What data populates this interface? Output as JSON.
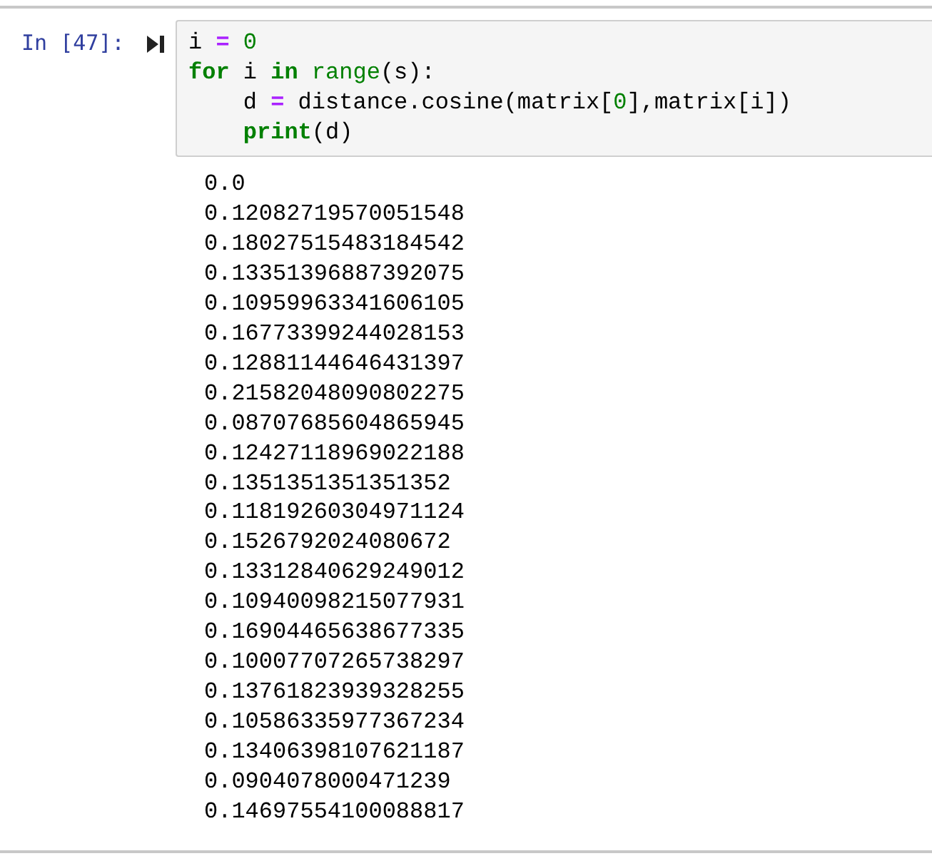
{
  "cell": {
    "prompt": "In [47]:",
    "code_lines": [
      {
        "indented": false,
        "tokens": [
          {
            "text": "i ",
            "kind": "plain"
          },
          {
            "text": "=",
            "kind": "op"
          },
          {
            "text": " 0",
            "kind": "num"
          }
        ]
      },
      {
        "indented": false,
        "tokens": [
          {
            "text": "for",
            "kind": "kw"
          },
          {
            "text": " i ",
            "kind": "plain"
          },
          {
            "text": "in",
            "kind": "kw"
          },
          {
            "text": " range",
            "kind": "builtin"
          },
          {
            "text": "(s):",
            "kind": "plain"
          }
        ]
      },
      {
        "indented": true,
        "tokens": [
          {
            "text": "d ",
            "kind": "plain"
          },
          {
            "text": "=",
            "kind": "op"
          },
          {
            "text": " distance.cosine(matrix[",
            "kind": "plain"
          },
          {
            "text": "0",
            "kind": "num"
          },
          {
            "text": "],matrix[i])",
            "kind": "plain"
          }
        ]
      },
      {
        "indented": true,
        "tokens": [
          {
            "text": "print",
            "kind": "kw"
          },
          {
            "text": "(d)",
            "kind": "plain"
          }
        ]
      }
    ],
    "output": [
      "0.0",
      "0.12082719570051548",
      "0.18027515483184542",
      "0.13351396887392075",
      "0.10959963341606105",
      "0.16773399244028153",
      "0.12881144646431397",
      "0.21582048090802275",
      "0.08707685604865945",
      "0.12427118969022188",
      "0.1351351351351352",
      "0.11819260304971124",
      "0.1526792024080672",
      "0.13312840629249012",
      "0.10940098215077931",
      "0.16904465638677335",
      "0.10007707265738297",
      "0.13761823939328255",
      "0.10586335977367234",
      "0.13406398107621187",
      "0.0904078000471239",
      "0.14697554100088817"
    ]
  }
}
